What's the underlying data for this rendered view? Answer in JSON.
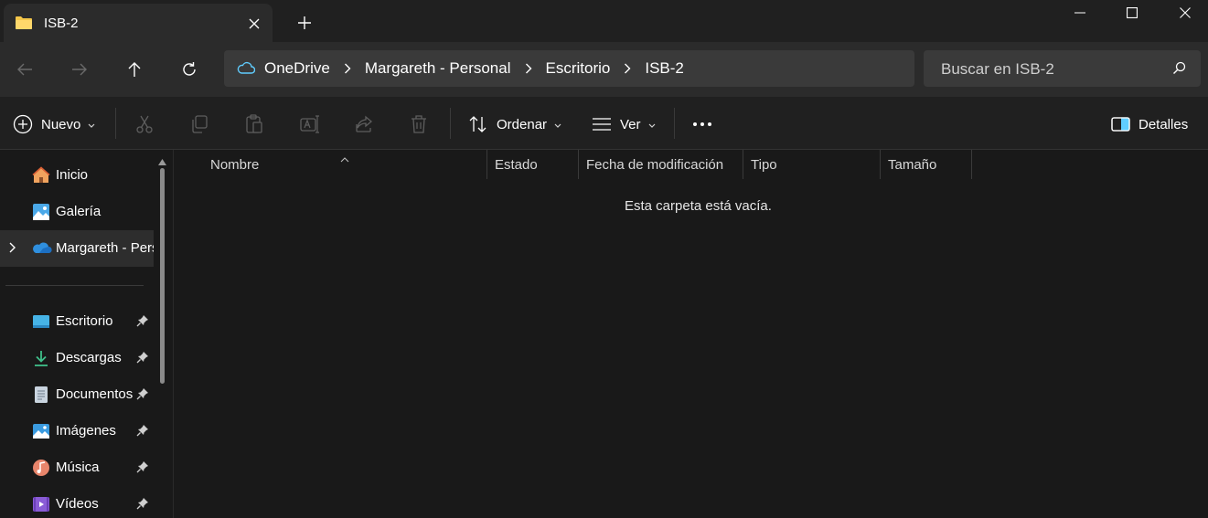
{
  "window": {
    "tab_title": "ISB-2",
    "icons": {
      "tab": "folder-icon",
      "close_tab": "close-icon",
      "new_tab": "plus-icon",
      "minimize": "minimize-icon",
      "maximize": "maximize-icon",
      "close_window": "close-icon"
    }
  },
  "navigation": {
    "back": "back-arrow-icon",
    "forward": "forward-arrow-icon",
    "up": "up-arrow-icon",
    "refresh": "refresh-icon"
  },
  "address_bar": {
    "icon": "cloud-icon",
    "breadcrumbs": [
      "OneDrive",
      "Margareth - Personal",
      "Escritorio",
      "ISB-2"
    ]
  },
  "search": {
    "placeholder": "Buscar en ISB-2"
  },
  "command_bar": {
    "new_label": "Nuevo",
    "sort_label": "Ordenar",
    "view_label": "Ver",
    "details_label": "Detalles",
    "disabled_icons": [
      "cut-icon",
      "copy-icon",
      "paste-icon",
      "rename-icon",
      "share-icon",
      "delete-icon"
    ]
  },
  "sidebar": {
    "top_items": [
      {
        "label": "Inicio",
        "icon": "home-icon"
      },
      {
        "label": "Galería",
        "icon": "gallery-icon"
      },
      {
        "label": "Margareth - Personal",
        "icon": "onedrive-icon",
        "selected": true
      }
    ],
    "pinned_items": [
      {
        "label": "Escritorio",
        "icon": "desktop-icon"
      },
      {
        "label": "Descargas",
        "icon": "download-icon"
      },
      {
        "label": "Documentos",
        "icon": "document-icon"
      },
      {
        "label": "Imágenes",
        "icon": "pictures-icon"
      },
      {
        "label": "Música",
        "icon": "music-icon"
      },
      {
        "label": "Vídeos",
        "icon": "videos-icon"
      }
    ]
  },
  "content": {
    "columns": [
      "Nombre",
      "Estado",
      "Fecha de modificación",
      "Tipo",
      "Tamaño"
    ],
    "empty_message": "Esta carpeta está vacía."
  },
  "colors": {
    "background": "#191919",
    "accent": "#60cdff",
    "folder": "#f4c64a"
  }
}
